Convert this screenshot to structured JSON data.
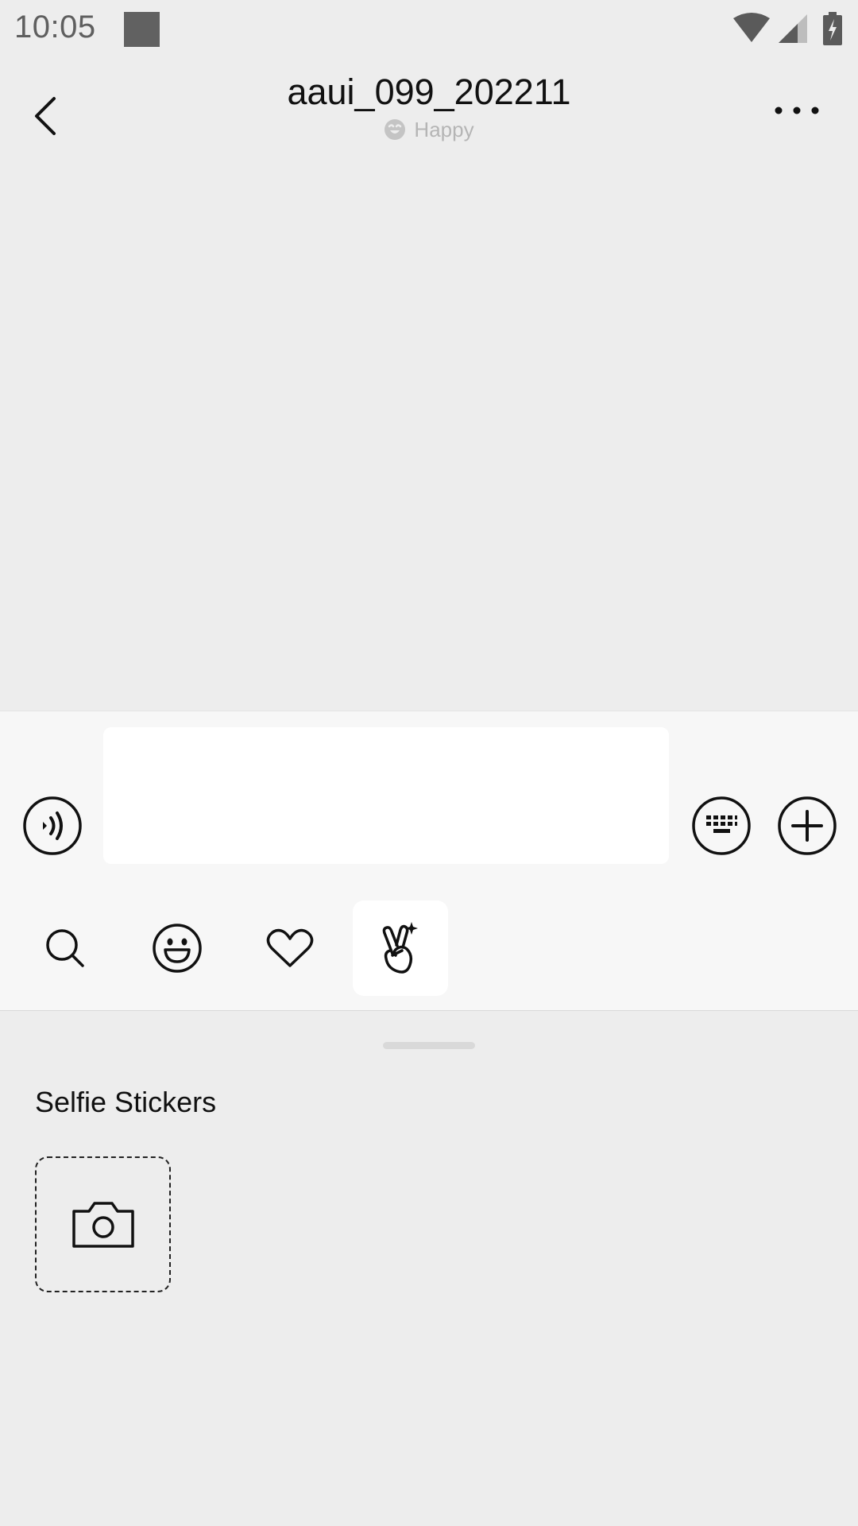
{
  "status_bar": {
    "time": "10:05"
  },
  "header": {
    "title": "aaui_099_202211",
    "status": "Happy"
  },
  "composer": {
    "message_value": ""
  },
  "stickers": {
    "section_title": "Selfie Stickers"
  },
  "icons": {
    "back": "back-chevron-icon",
    "more": "more-dots-icon",
    "mood": "smiley-icon",
    "voice": "voice-icon",
    "keyboard": "keyboard-icon",
    "add": "plus-circle-icon",
    "search": "search-icon",
    "emoji": "emoji-icon",
    "favorites": "heart-icon",
    "stickers": "victory-hand-icon",
    "camera": "camera-icon"
  },
  "colors": {
    "background": "#ededed",
    "composer": "#f7f7f7",
    "active_tab": "#ffffff",
    "icon_stroke": "#111111",
    "status_text": "#b5b5b5"
  }
}
